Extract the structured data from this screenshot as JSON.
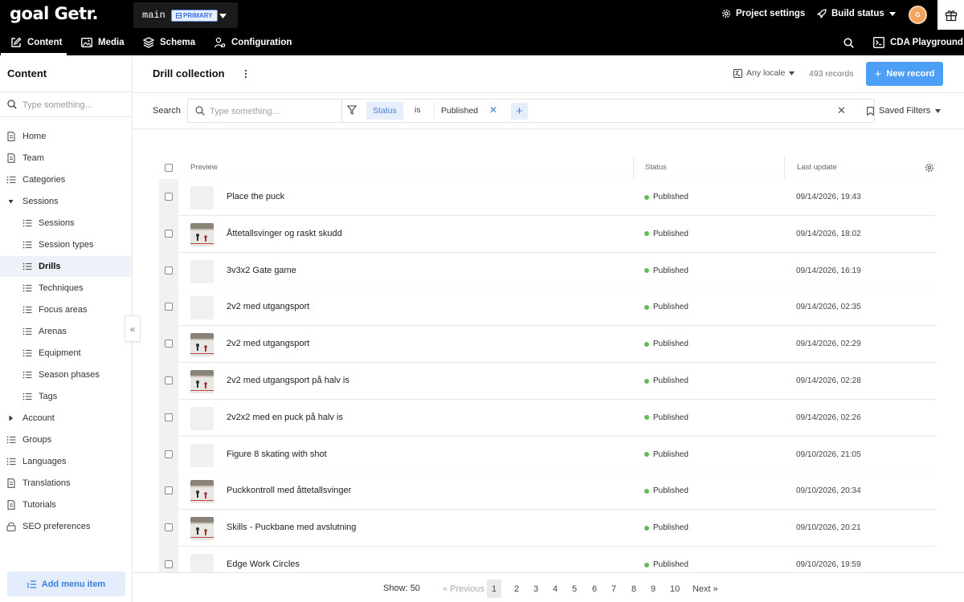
{
  "app": {
    "logo": "goal Getr.",
    "environment": "main",
    "environment_badge": "PRIMARY",
    "project_settings": "Project settings",
    "build_status": "Build status",
    "avatar_initial": "G"
  },
  "nav": {
    "content": "Content",
    "media": "Media",
    "schema": "Schema",
    "configuration": "Configuration",
    "cda_playground": "CDA Playground"
  },
  "sidebar": {
    "title": "Content",
    "search_placeholder": "Type something...",
    "items": [
      {
        "label": "Home",
        "icon": "document-icon",
        "level": 0
      },
      {
        "label": "Team",
        "icon": "document-icon",
        "level": 0
      },
      {
        "label": "Categories",
        "icon": "list-icon",
        "level": 0
      },
      {
        "label": "Sessions",
        "icon": "caret-down-icon",
        "level": 0
      },
      {
        "label": "Sessions",
        "icon": "list-icon",
        "level": 1
      },
      {
        "label": "Session types",
        "icon": "list-icon",
        "level": 1
      },
      {
        "label": "Drills",
        "icon": "list-icon",
        "level": 1,
        "active": true
      },
      {
        "label": "Techniques",
        "icon": "list-icon",
        "level": 1
      },
      {
        "label": "Focus areas",
        "icon": "list-icon",
        "level": 1
      },
      {
        "label": "Arenas",
        "icon": "list-icon",
        "level": 1
      },
      {
        "label": "Equipment",
        "icon": "list-icon",
        "level": 1
      },
      {
        "label": "Season phases",
        "icon": "list-icon",
        "level": 1
      },
      {
        "label": "Tags",
        "icon": "list-icon",
        "level": 1
      },
      {
        "label": "Account",
        "icon": "caret-right-icon",
        "level": 0
      },
      {
        "label": "Groups",
        "icon": "list-icon",
        "level": 0
      },
      {
        "label": "Languages",
        "icon": "list-icon",
        "level": 0
      },
      {
        "label": "Translations",
        "icon": "document-icon",
        "level": 0
      },
      {
        "label": "Tutorials",
        "icon": "document-icon",
        "level": 0
      },
      {
        "label": "SEO preferences",
        "icon": "lock-icon",
        "level": 0
      }
    ],
    "add_menu_item": "Add menu item"
  },
  "main": {
    "title": "Drill collection",
    "locale": "Any locale",
    "records": "493 records",
    "new_record": "New record"
  },
  "filter": {
    "search_label": "Search",
    "search_placeholder": "Type something...",
    "field": "Status",
    "operator": "is",
    "value": "Published",
    "saved_filters": "Saved Filters"
  },
  "table": {
    "headers": {
      "preview": "Preview",
      "status": "Status",
      "last_update": "Last update"
    },
    "rows": [
      {
        "title": "Place the puck",
        "status": "Published",
        "date": "09/14/2026, 19:43",
        "photo": false
      },
      {
        "title": "Åttetallsvinger og raskt skudd",
        "status": "Published",
        "date": "09/14/2026, 18:02",
        "photo": true
      },
      {
        "title": "3v3x2 Gate game",
        "status": "Published",
        "date": "09/14/2026, 16:19",
        "photo": false
      },
      {
        "title": "2v2 med utgangsport",
        "status": "Published",
        "date": "09/14/2026, 02:35",
        "photo": false
      },
      {
        "title": "2v2 med utgangsport",
        "status": "Published",
        "date": "09/14/2026, 02:29",
        "photo": true
      },
      {
        "title": "2v2 med utgangsport på halv is",
        "status": "Published",
        "date": "09/14/2026, 02:28",
        "photo": true
      },
      {
        "title": "2v2x2 med en puck på halv is",
        "status": "Published",
        "date": "09/14/2026, 02:26",
        "photo": false
      },
      {
        "title": "Figure 8 skating with shot",
        "status": "Published",
        "date": "09/10/2026, 21:05",
        "photo": false
      },
      {
        "title": "Puckkontroll med åttetallsvinger",
        "status": "Published",
        "date": "09/10/2026, 20:34",
        "photo": true
      },
      {
        "title": "Skills - Puckbane med avslutning",
        "status": "Published",
        "date": "09/10/2026, 20:21",
        "photo": true
      },
      {
        "title": "Edge Work Circles",
        "status": "Published",
        "date": "09/10/2026, 19:59",
        "photo": false
      }
    ]
  },
  "pagination": {
    "show": "Show: 50",
    "previous": "« Previous",
    "pages": [
      "1",
      "2",
      "3",
      "4",
      "5",
      "6",
      "7",
      "8",
      "9",
      "10"
    ],
    "current": "1",
    "next": "Next »"
  },
  "colors": {
    "accent": "#4d9ef5",
    "published": "#5fbf52",
    "topbar": "#000000"
  }
}
